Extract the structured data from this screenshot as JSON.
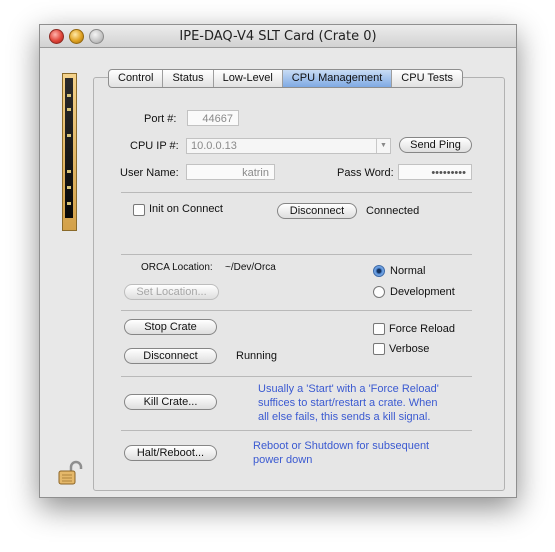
{
  "window": {
    "title": "IPE-DAQ-V4 SLT Card (Crate 0)"
  },
  "tabs": [
    {
      "label": "Control",
      "active": false
    },
    {
      "label": "Status",
      "active": false
    },
    {
      "label": "Low-Level",
      "active": false
    },
    {
      "label": "CPU Management",
      "active": true
    },
    {
      "label": "CPU Tests",
      "active": false
    }
  ],
  "connection": {
    "port_label": "Port #:",
    "port_value": "44667",
    "cpu_ip_label": "CPU IP #:",
    "cpu_ip_value": "10.0.0.13",
    "send_ping_label": "Send Ping",
    "user_label": "User Name:",
    "user_value": "katrin",
    "pass_label": "Pass Word:",
    "pass_value": "•••••••••",
    "init_on_connect_label": "Init on Connect",
    "init_on_connect_checked": false,
    "disconnect_label": "Disconnect",
    "status": "Connected"
  },
  "orca": {
    "location_label": "ORCA Location:",
    "location_value": "~/Dev/Orca",
    "set_location_label": "Set Location...",
    "mode_options": [
      {
        "label": "Normal",
        "selected": true
      },
      {
        "label": "Development",
        "selected": false
      }
    ]
  },
  "crate": {
    "stop_label": "Stop Crate",
    "disconnect_label": "Disconnect",
    "status": "Running",
    "force_reload_label": "Force Reload",
    "force_reload_checked": false,
    "verbose_label": "Verbose",
    "verbose_checked": false
  },
  "kill": {
    "button_label": "Kill Crate...",
    "help_lines": [
      "Usually a 'Start' with a 'Force Reload'",
      "suffices to start/restart a crate. When",
      "all else fails, this sends a kill signal."
    ]
  },
  "halt": {
    "button_label": "Halt/Reboot...",
    "help_lines": [
      "Reboot or Shutdown for subsequent",
      "power down"
    ]
  },
  "colors": {
    "help_text": "#3b5ad1",
    "active_tab": "#7fa9e3"
  },
  "icons": {
    "lock": "lock-open-icon",
    "card": "slt-card-image"
  }
}
